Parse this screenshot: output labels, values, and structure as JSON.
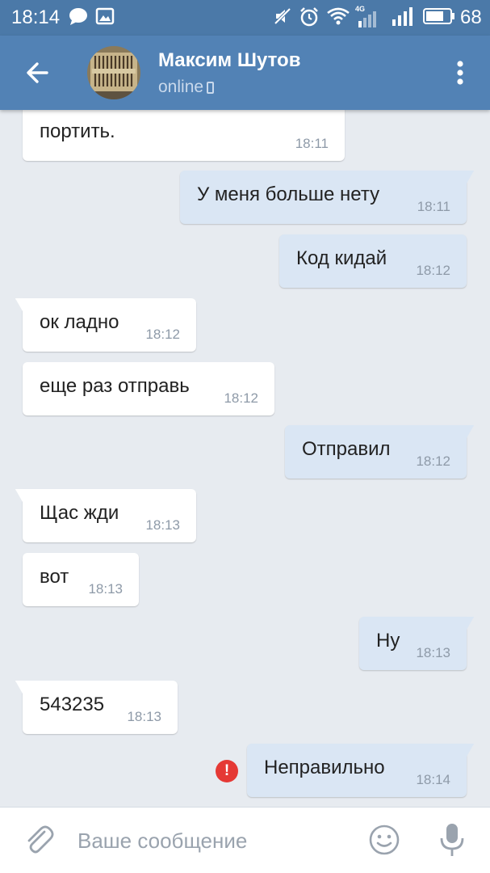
{
  "status_bar": {
    "time": "18:14",
    "battery": "68",
    "network": "4G",
    "icons": [
      "chat-notification-icon",
      "image-notification-icon",
      "mute-icon",
      "alarm-icon",
      "wifi-icon",
      "signal-4g-icon",
      "signal-icon",
      "battery-icon"
    ]
  },
  "header": {
    "contact_name": "Максим Шутов",
    "status": "online",
    "icons": [
      "back-arrow-icon",
      "avatar",
      "mobile-device-icon",
      "more-vert-icon"
    ]
  },
  "messages": [
    {
      "dir": "in",
      "text": "портить.",
      "time": "18:11"
    },
    {
      "dir": "out",
      "text": "У меня больше нету",
      "time": "18:11"
    },
    {
      "dir": "out",
      "text": "Код кидай",
      "time": "18:12"
    },
    {
      "dir": "in",
      "text": "ок ладно",
      "time": "18:12"
    },
    {
      "dir": "in",
      "text": "еще раз отправь",
      "time": "18:12"
    },
    {
      "dir": "out",
      "text": "Отправил",
      "time": "18:12"
    },
    {
      "dir": "in",
      "text": "Щас жди",
      "time": "18:13"
    },
    {
      "dir": "in",
      "text": "вот",
      "time": "18:13"
    },
    {
      "dir": "out",
      "text": "Ну",
      "time": "18:13"
    },
    {
      "dir": "in",
      "text": "543235",
      "time": "18:13"
    },
    {
      "dir": "out",
      "text": "Неправильно",
      "time": "18:14",
      "failed": true
    }
  ],
  "composer": {
    "placeholder": "Ваше сообщение",
    "icons": [
      "attach-icon",
      "emoji-icon",
      "microphone-icon"
    ]
  },
  "colors": {
    "status_bar": "#4b79a8",
    "app_bar": "#5282b5",
    "chat_background": "#e7ebf0",
    "incoming_bubble": "#ffffff",
    "outgoing_bubble": "#dae6f4",
    "timestamp": "#8e9aa8",
    "error": "#e53935"
  }
}
